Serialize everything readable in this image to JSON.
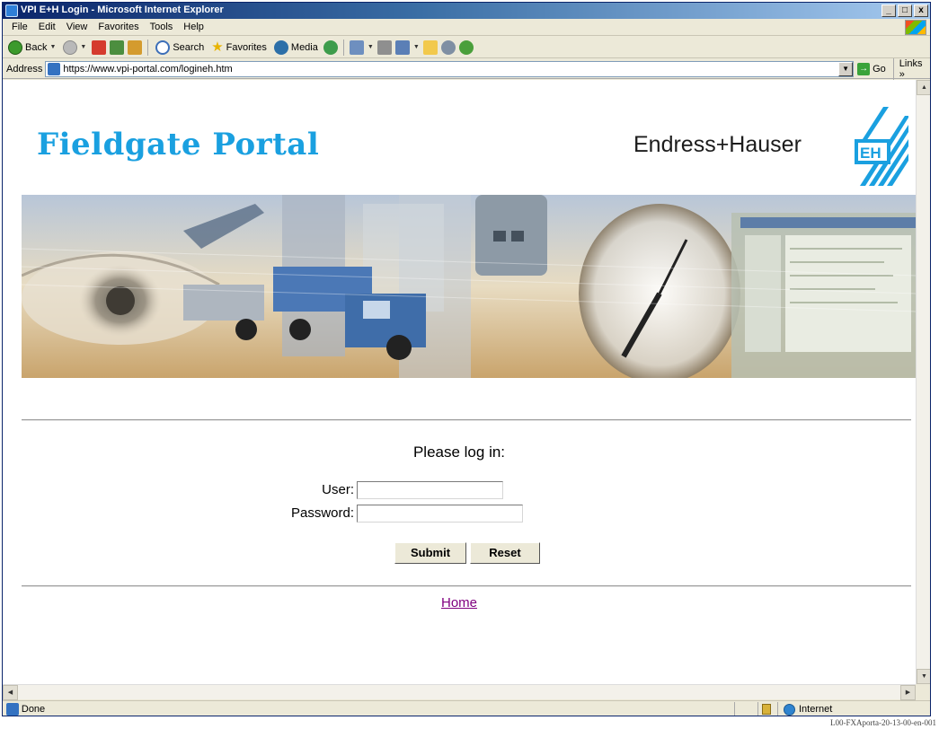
{
  "window": {
    "title": "VPI E+H Login - Microsoft Internet Explorer",
    "buttons": {
      "minimize": "_",
      "maximize": "□",
      "close": "x"
    }
  },
  "menu": {
    "items": [
      {
        "label": "File"
      },
      {
        "label": "Edit"
      },
      {
        "label": "View"
      },
      {
        "label": "Favorites"
      },
      {
        "label": "Tools"
      },
      {
        "label": "Help"
      }
    ]
  },
  "toolbar": {
    "back_label": "Back",
    "search_label": "Search",
    "favorites_label": "Favorites",
    "media_label": "Media"
  },
  "address": {
    "label": "Address",
    "url": "https://www.vpi-portal.com/logineh.htm",
    "go_label": "Go",
    "links_label": "Links »"
  },
  "page": {
    "title": "Fieldgate Portal",
    "brand_name": "Endress+Hauser",
    "prompt": "Please log in:",
    "user_label": "User:",
    "user_value": "",
    "password_label": "Password:",
    "password_value": "",
    "submit_label": "Submit",
    "reset_label": "Reset",
    "home_link": "Home"
  },
  "status": {
    "text": "Done",
    "zone": "Internet"
  },
  "caption": "L00-FXAporta-20-13-00-en-001",
  "colors": {
    "title_blue": "#1aa0e0",
    "link_visited": "#800080",
    "titlebar": "#0a246a"
  }
}
